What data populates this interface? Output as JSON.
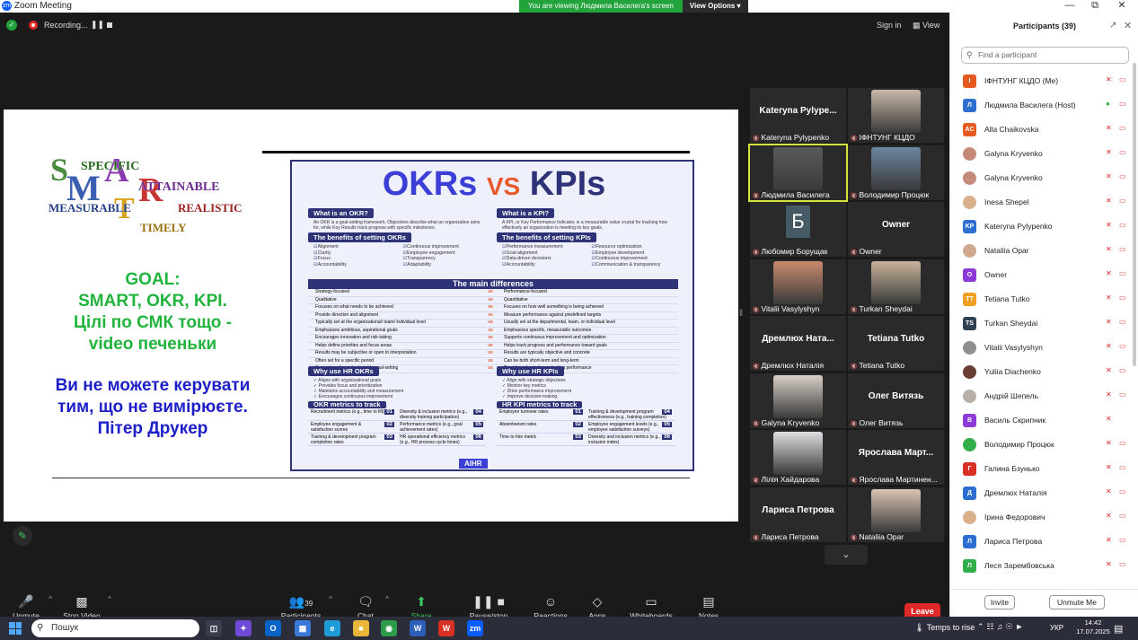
{
  "window": {
    "title": "Zoom Meeting",
    "app_icon": "zoom-logo-icon"
  },
  "banner": {
    "message": "You are viewing Людмила Василега's screen",
    "view_options": "View Options"
  },
  "meeting_top": {
    "recording_label": "Recording...",
    "signin": "Sign in",
    "view": "View"
  },
  "slide": {
    "smart_words": {
      "specific": "SPECIFIC",
      "attainable": "ATTAINABLE",
      "measurable": "MEASURABLE",
      "realistic": "REALISTIC",
      "timely": "TIMELY"
    },
    "goal_lines": [
      "GOAL:",
      "SMART, OKR, KPI.",
      "Цілі по СМК тощо  -",
      "video печеньки"
    ],
    "quote_lines": [
      "Ви не можете керувати",
      "тим, що не вимірюєте.",
      "Пітер Друкер"
    ],
    "infographic": {
      "title_left": "OKRs",
      "title_vs": "VS",
      "title_right": "KPIs",
      "okr_what_head": "What is an OKR?",
      "okr_what_text": "An OKR is a goal-setting framework. Objectives describe what an organization aims for, while Key Results track progress with specific milestones.",
      "kpi_what_head": "What is a KPI?",
      "kpi_what_text": "A KPI, or Key Performance Indicator, is a measurable value crucial for tracking how effectively an organization is meeting its key goals.",
      "okr_benefits_head": "The benefits of setting OKRs",
      "okr_benefits": [
        "Alignment",
        "Continuous improvement",
        "Clarity",
        "Employee engagement",
        "Focus",
        "Transparency",
        "Accountability",
        "Adaptability"
      ],
      "kpi_benefits_head": "The benefits of setting KPIs",
      "kpi_benefits": [
        "Performance measurement",
        "Resource optimization",
        "Goal alignment",
        "Employee development",
        "Data-driven decisions",
        "Continuous improvement",
        "Accountability",
        "Communication & transparency"
      ],
      "main_diff_head": "The main differences",
      "differences": [
        [
          "Strategy-focused",
          "Performance-focused"
        ],
        [
          "Qualitative",
          "Quantitative"
        ],
        [
          "Focuses on what needs to be achieved",
          "Focuses on how well something is being achieved"
        ],
        [
          "Provide direction and alignment",
          "Measure performance against predefined targets"
        ],
        [
          "Typically set at the organizational/ team/ individual level",
          "Usually set at the departmental, team, or individual level"
        ],
        [
          "Emphasizes ambitious, aspirational goals",
          "Emphasizes specific, measurable outcomes"
        ],
        [
          "Encourages innovation and risk-taking",
          "Supports continuous improvement and optimization"
        ],
        [
          "Helps define priorities and focus areas",
          "Helps track progress and performance toward goals"
        ],
        [
          "Results may be subjective or open to interpretation",
          "Results are typically objective and concrete"
        ],
        [
          "Often set for a specific period",
          "Can be both short-term and long-term"
        ],
        [
          "Supports agile and adaptable goal-setting",
          "Provides a basis for evaluating performance"
        ]
      ],
      "why_okr_head": "Why use HR OKRs",
      "why_okr": [
        "Aligns with organizational goals",
        "Provides focus and prioritization",
        "Maintains accountability and measurement",
        "Encourages continuous improvement"
      ],
      "why_kpi_head": "Why use HR KPIs",
      "why_kpi": [
        "Align with strategic objectives",
        "Monitor key metrics",
        "Drive performance improvement",
        "Improve decision-making"
      ],
      "okr_metrics_head": "OKR metrics to track",
      "okr_metrics": [
        [
          "01",
          "Recruitment metrics (e.g., time to fill)"
        ],
        [
          "04",
          "Diversity & inclusion metrics (e.g., diversity training participation)"
        ],
        [
          "02",
          "Employee engagement & satisfaction scores"
        ],
        [
          "05",
          "Performance metrics (e.g., goal achievement rates)"
        ],
        [
          "03",
          "Training & development program completion rates"
        ],
        [
          "06",
          "HR operational efficiency metrics (e.g., HR process cycle times)"
        ]
      ],
      "kpi_metrics_head": "HR KPI metrics to track",
      "kpi_metrics": [
        [
          "01",
          "Employee turnover rates"
        ],
        [
          "04",
          "Training & development program effectiveness (e.g., training completion)"
        ],
        [
          "02",
          "Absenteeism rates"
        ],
        [
          "05",
          "Employee engagement levels (e.g., employee satisfaction surveys)"
        ],
        [
          "03",
          "Time to hire metric"
        ],
        [
          "06",
          "Diversity and inclusion metrics (e.g., inclusion index)"
        ]
      ],
      "brand": "AIHR"
    }
  },
  "video_tiles": [
    {
      "big": "Kateryna Pylype...",
      "name": "Kateryna Pylypenko"
    },
    {
      "big": "",
      "name": "ІФНТУНГ КЦДО",
      "photo": "#c9b8a8"
    },
    {
      "big": "",
      "name": "Людмила Василега",
      "photo": "#5a5a5a"
    },
    {
      "big": "",
      "name": "Володимир Процюк",
      "photo": "#6b86a0"
    },
    {
      "big": "",
      "name": "Любомир Борущак",
      "letter": "Б"
    },
    {
      "big": "Owner",
      "name": "Owner"
    },
    {
      "big": "",
      "name": "Vitalii Vasylyshyn",
      "photo": "#c98a6e"
    },
    {
      "big": "",
      "name": "Turkan Sheydai",
      "photo": "#c8b29a"
    },
    {
      "big": "Дремлюх Ната...",
      "name": "Дремлюх Наталія"
    },
    {
      "big": "Tetiana Tutko",
      "name": "Tetiana Tutko"
    },
    {
      "big": "",
      "name": "Galyna Kryvenko",
      "photo": "#d8cfc8"
    },
    {
      "big": "Олег Витязь",
      "name": "Олег Витязь"
    },
    {
      "big": "",
      "name": "Лілія Хайдарова",
      "photo": "#e0dde0"
    },
    {
      "big": "Ярослава Март...",
      "name": "Ярослава Мартинен..."
    },
    {
      "big": "Лариса Петрова",
      "name": "Лариса Петрова"
    },
    {
      "big": "",
      "name": "Nataliia Opar",
      "photo": "#d9c4b4"
    }
  ],
  "toolbar": {
    "unmute": "Unmute",
    "stop_video": "Stop Video",
    "participants_count": "39",
    "participants": "Participants",
    "chat": "Chat",
    "share": "Share Screen",
    "record": "Pause/stop recording",
    "reactions": "Reactions",
    "apps": "Apps",
    "whiteboards": "Whiteboards",
    "notes": "Notes",
    "leave": "Leave"
  },
  "panel": {
    "title": "Participants (39)",
    "search_placeholder": "Find a participant",
    "invite": "Invite",
    "unmute_me": "Unmute Me",
    "participants": [
      {
        "initials": "I",
        "color": "#e55a1f",
        "name": "ІФНТУНГ КЦДО (Me)"
      },
      {
        "initials": "Л",
        "color": "#2d6fd1",
        "name": "Людмила Василега (Host)"
      },
      {
        "initials": "AC",
        "color": "#e55a1f",
        "name": "Alla Chaikovska"
      },
      {
        "initials": "",
        "color": "#c48a7a",
        "name": "Galyna Kryvenko"
      },
      {
        "initials": "",
        "color": "#c48a7a",
        "name": "Galyna Kryvenko"
      },
      {
        "initials": "",
        "color": "#d8b08a",
        "name": "Inesa Shepel"
      },
      {
        "initials": "KP",
        "color": "#2d6fd1",
        "name": "Kateryna Pylypenko"
      },
      {
        "initials": "",
        "color": "#cfa88e",
        "name": "Nataliia Opar"
      },
      {
        "initials": "O",
        "color": "#8e3ad6",
        "name": "Owner"
      },
      {
        "initials": "TT",
        "color": "#f0a020",
        "name": "Tetiana Tutko"
      },
      {
        "initials": "TS",
        "color": "#2f4050",
        "name": "Turkan Sheydai"
      },
      {
        "initials": "",
        "color": "#8f8f8f",
        "name": "Vitalii Vasylyshyn"
      },
      {
        "initials": "",
        "color": "#6a3e34",
        "name": "Yuliia Diachenko"
      },
      {
        "initials": "",
        "color": "#b8b0a8",
        "name": "Андрій Шепель"
      },
      {
        "initials": "В",
        "color": "#8e3ad6",
        "name": "Василь Скрипник"
      },
      {
        "initials": "",
        "color": "#2fae4a",
        "name": "Володимир Процюк"
      },
      {
        "initials": "Г",
        "color": "#d93025",
        "name": "Галина Бзунько"
      },
      {
        "initials": "Д",
        "color": "#2d6fd1",
        "name": "Дремлюх Наталія"
      },
      {
        "initials": "",
        "color": "#d8b08a",
        "name": "Ірина Федорович"
      },
      {
        "initials": "Л",
        "color": "#2d6fd1",
        "name": "Лариса Петрова"
      },
      {
        "initials": "Л",
        "color": "#2fae4a",
        "name": "Леся Зарембовська"
      }
    ]
  },
  "taskbar": {
    "search": "Пошук",
    "weather": "Temps to rise",
    "lang": "УКР",
    "time": "14:42",
    "date": "17.07.2025"
  }
}
